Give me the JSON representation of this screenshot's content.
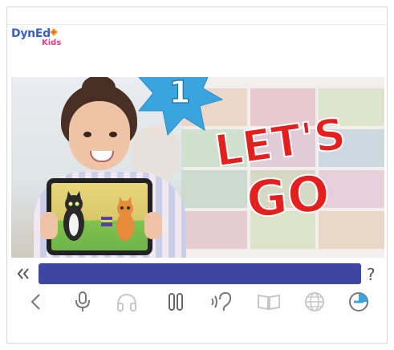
{
  "brand": {
    "logo_main": "DynEd",
    "logo_sub": "Kids",
    "colors": {
      "logo_blue": "#3a5fc4",
      "logo_pink": "#e0408a",
      "flower": "#f4a21f"
    }
  },
  "lesson": {
    "number": "1",
    "title_line1": "LET'S",
    "title_line2": "GO",
    "colors": {
      "star": "#3aa4df",
      "title_red": "#e51e1e",
      "progress_bar": "#3d46a1"
    }
  },
  "controls": {
    "rewind_icon": "double-chevron-left-icon",
    "help_label": "?",
    "toolbar": [
      {
        "name": "back-button",
        "icon": "chevron-left-icon",
        "enabled": true
      },
      {
        "name": "microphone-button",
        "icon": "microphone-icon",
        "enabled": true
      },
      {
        "name": "headphones-button",
        "icon": "headphones-icon",
        "enabled": false
      },
      {
        "name": "pause-button",
        "icon": "pause-icon",
        "enabled": true
      },
      {
        "name": "listen-button",
        "icon": "ear-icon",
        "enabled": true
      },
      {
        "name": "book-button",
        "icon": "book-icon",
        "enabled": false
      },
      {
        "name": "globe-button",
        "icon": "globe-icon",
        "enabled": false
      },
      {
        "name": "timer-button",
        "icon": "timer-icon",
        "enabled": true
      }
    ]
  }
}
